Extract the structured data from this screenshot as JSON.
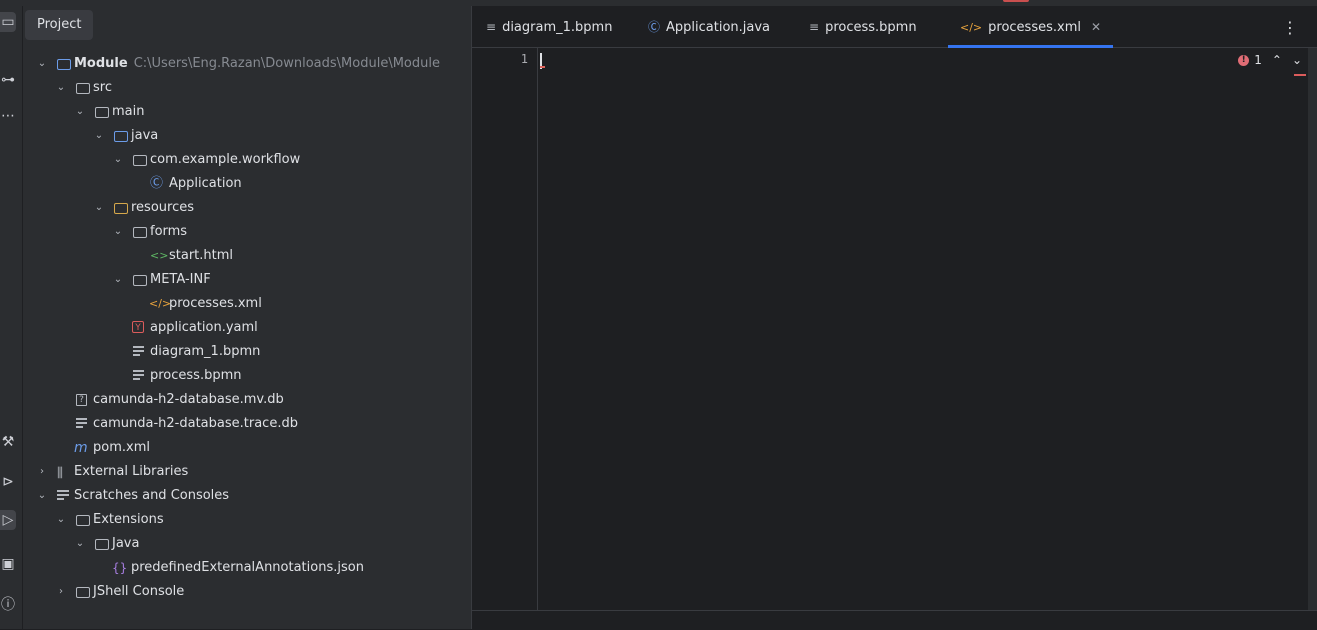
{
  "project_panel": {
    "title": "Project",
    "tree": [
      {
        "label": "Module",
        "path": "C:\\Users\\Eng.Razan\\Downloads\\Module\\Module",
        "icon": "module-folder-icon",
        "expanded": true
      },
      {
        "label": "src",
        "icon": "folder-icon",
        "expanded": true
      },
      {
        "label": "main",
        "icon": "folder-icon",
        "expanded": true
      },
      {
        "label": "java",
        "icon": "source-folder-icon",
        "expanded": true
      },
      {
        "label": "com.example.workflow",
        "icon": "package-icon",
        "expanded": true
      },
      {
        "label": "Application",
        "icon": "java-class-icon"
      },
      {
        "label": "resources",
        "icon": "resources-folder-icon",
        "expanded": true
      },
      {
        "label": "forms",
        "icon": "folder-icon",
        "expanded": true
      },
      {
        "label": "start.html",
        "icon": "html-file-icon"
      },
      {
        "label": "META-INF",
        "icon": "folder-icon",
        "expanded": true
      },
      {
        "label": "processes.xml",
        "icon": "xml-file-icon"
      },
      {
        "label": "application.yaml",
        "icon": "yaml-file-icon"
      },
      {
        "label": "diagram_1.bpmn",
        "icon": "text-file-icon"
      },
      {
        "label": "process.bpmn",
        "icon": "text-file-icon"
      },
      {
        "label": "camunda-h2-database.mv.db",
        "icon": "unknown-file-icon"
      },
      {
        "label": "camunda-h2-database.trace.db",
        "icon": "text-file-icon"
      },
      {
        "label": "pom.xml",
        "icon": "maven-file-icon"
      },
      {
        "label": "External Libraries",
        "icon": "libraries-icon",
        "expanded": false
      },
      {
        "label": "Scratches and Consoles",
        "icon": "scratches-icon",
        "expanded": true
      },
      {
        "label": "Extensions",
        "icon": "folder-icon",
        "expanded": true
      },
      {
        "label": "Java",
        "icon": "folder-icon",
        "expanded": true
      },
      {
        "label": "predefinedExternalAnnotations.json",
        "icon": "json-file-icon"
      },
      {
        "label": "JShell Console",
        "icon": "folder-icon",
        "expanded": false
      }
    ]
  },
  "editor": {
    "tabs": [
      {
        "label": "diagram_1.bpmn",
        "icon": "text-file-icon",
        "active": false
      },
      {
        "label": "Application.java",
        "icon": "java-class-icon",
        "active": false
      },
      {
        "label": "process.bpmn",
        "icon": "text-file-icon",
        "active": false
      },
      {
        "label": "processes.xml",
        "icon": "xml-file-icon",
        "active": true
      }
    ],
    "line_numbers": [
      "1"
    ],
    "error_count": "1"
  },
  "colors": {
    "accent": "#3574f0",
    "error": "#e06c75",
    "xml_icon": "#e8a33d",
    "java_icon": "#6c9ce8"
  }
}
